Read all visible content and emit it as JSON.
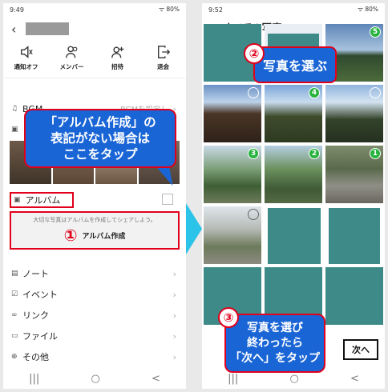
{
  "left": {
    "status": {
      "time": "9:49",
      "right": "ᯤ 80%"
    },
    "menu": {
      "notify": "通知オフ",
      "members": "メンバー",
      "invite": "招待",
      "leave": "退会"
    },
    "rows": {
      "bgm": "BGM",
      "bgm_sub": "BGMを設定し",
      "album": "アルバム",
      "note": "ノート",
      "event": "イベント",
      "link": "リンク",
      "file": "ファイル",
      "other": "その他"
    },
    "album_box": {
      "hint": "大切な写真はアルバムを作成してシェアしよう。",
      "num": "①",
      "button": "アルバム作成"
    },
    "callout": {
      "line1": "「アルバム作成」の",
      "line2": "表記がない場合は",
      "line3": "ここをタップ"
    }
  },
  "right": {
    "status": {
      "time": "9:52",
      "right": "ᯤ 80%"
    },
    "title": "すべての写真",
    "callout2": {
      "num": "②",
      "text": "写真を選ぶ"
    },
    "callout3": {
      "num": "③",
      "line1": "写真を選び",
      "line2": "終わったら",
      "line3": "「次へ」をタップ"
    },
    "next_button": "次へ",
    "badges": [
      "5",
      "4",
      "3",
      "2",
      "1"
    ]
  },
  "nav": {
    "recents": "|||",
    "home": "○",
    "back": "<"
  },
  "colors": {
    "callout": "#1a65d6",
    "accent_red": "#e0001b",
    "badge_green": "#28b33f",
    "arrow": "#2cc3e8",
    "placeholder": "#3d8a88"
  }
}
